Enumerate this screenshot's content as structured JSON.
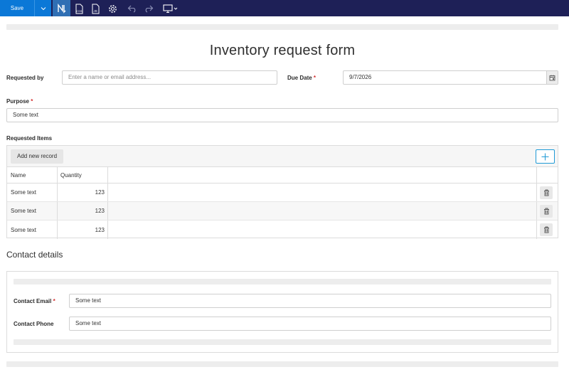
{
  "toolbar": {
    "save_label": "Save",
    "icons": [
      "chevron-down-icon",
      "form-designer-icon",
      "css-file-icon",
      "js-file-icon",
      "settings-gear-icon",
      "undo-icon",
      "redo-icon",
      "monitor-preview-icon"
    ]
  },
  "form": {
    "title": "Inventory request form",
    "requested_by": {
      "label": "Requested by",
      "placeholder": "Enter a name or email address..."
    },
    "due_date": {
      "label": "Due Date",
      "required_mark": "*",
      "value": "9/7/2026"
    },
    "purpose": {
      "label": "Purpose",
      "required_mark": "*",
      "value": "Some text"
    }
  },
  "items": {
    "label": "Requested Items",
    "add_record_label": "Add new record",
    "columns": [
      "Name",
      "Quantity"
    ],
    "rows": [
      {
        "name": "Some text",
        "quantity": "123"
      },
      {
        "name": "Some text",
        "quantity": "123"
      },
      {
        "name": "Some text",
        "quantity": "123"
      }
    ]
  },
  "contact": {
    "section_title": "Contact details",
    "email": {
      "label": "Contact Email",
      "required_mark": "*",
      "value": "Some text"
    },
    "phone": {
      "label": "Contact Phone",
      "value": "Some text"
    }
  },
  "colors": {
    "toolbar_bg": "#1e2057",
    "save_blue": "#0b78d7",
    "required_red": "#d32f2f",
    "accent_border": "#1f9ad6"
  }
}
